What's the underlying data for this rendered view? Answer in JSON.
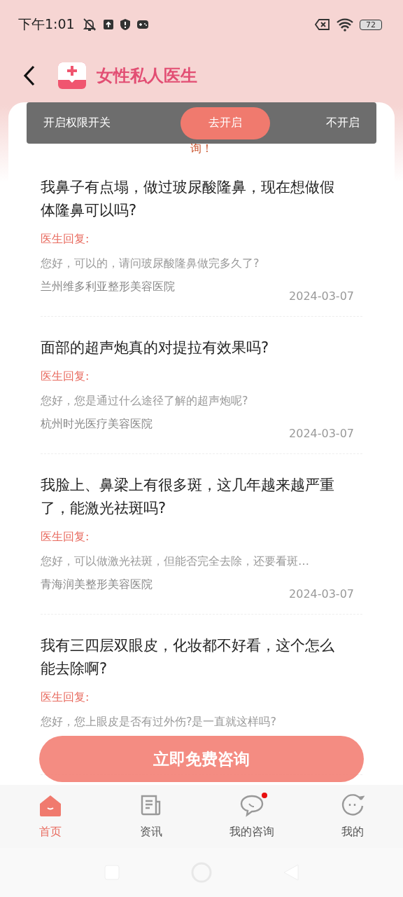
{
  "status_bar": {
    "time": "下午1:01",
    "battery": "72"
  },
  "header": {
    "title": "女性私人医生"
  },
  "notice": {
    "text": "询！"
  },
  "toast": {
    "label": "开启权限开关",
    "confirm": "去开启",
    "cancel": "不开启"
  },
  "questions": [
    {
      "question": "我鼻子有点塌，做过玻尿酸隆鼻，现在想做假体隆鼻可以吗?",
      "reply_label": "医生回复:",
      "answer": "您好，可以的，请问玻尿酸隆鼻做完多久了?",
      "hospital": "兰州维多利亚整形美容医院",
      "date": "2024-03-07"
    },
    {
      "question": "面部的超声炮真的对提拉有效果吗?",
      "reply_label": "医生回复:",
      "answer": "您好，您是通过什么途径了解的超声炮呢?",
      "hospital": "杭州时光医疗美容医院",
      "date": "2024-03-07"
    },
    {
      "question": "我脸上、鼻梁上有很多斑，这几年越来越严重了，能激光祛斑吗?",
      "reply_label": "医生回复:",
      "answer": "您好，可以做激光祛斑，但能否完全去除，还要看斑…",
      "hospital": "青海润美整形美容医院",
      "date": "2024-03-07"
    },
    {
      "question": "我有三四层双眼皮，化妆都不好看，这个怎么能去除啊?",
      "reply_label": "医生回复:",
      "answer": "您好，您上眼皮是否有过外伤?是一直就这样吗?"
    }
  ],
  "consult_button": {
    "label": "立即免费咨询"
  },
  "tabs": [
    {
      "kind": "home",
      "label": "首页",
      "selected": true,
      "badge": false
    },
    {
      "kind": "news",
      "label": "资讯",
      "selected": false,
      "badge": false
    },
    {
      "kind": "chat",
      "label": "我的咨询",
      "selected": false,
      "badge": true
    },
    {
      "kind": "profile",
      "label": "我的",
      "selected": false,
      "badge": false
    }
  ]
}
